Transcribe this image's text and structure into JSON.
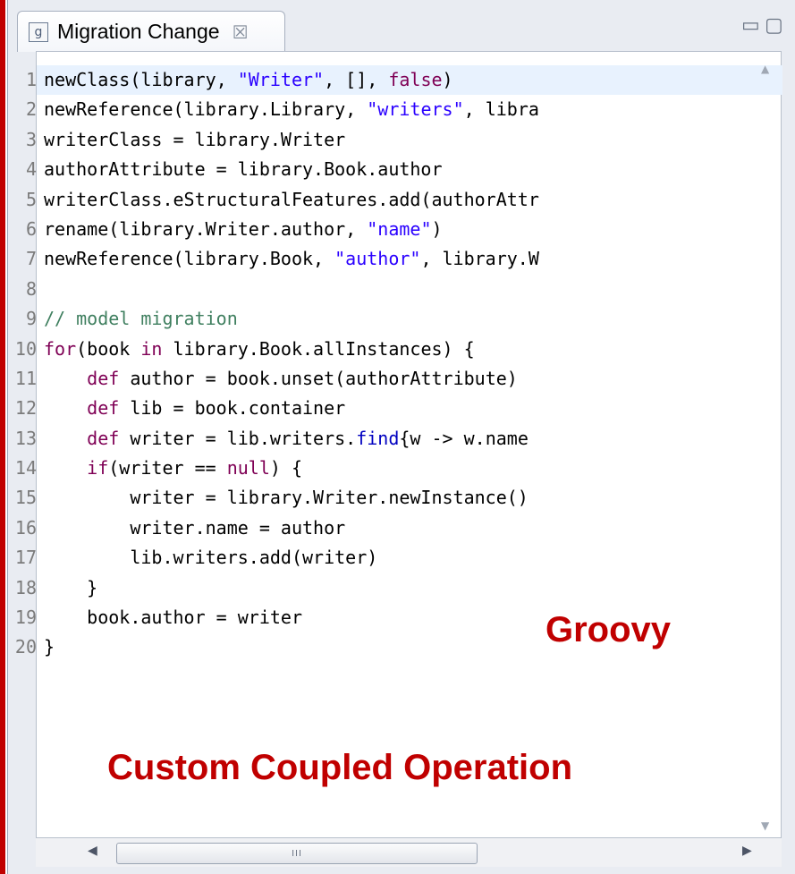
{
  "tab": {
    "icon_glyph": "g",
    "title": "Migration Change",
    "close_glyph": "☒"
  },
  "view_controls": {
    "minimize_glyph": "▭",
    "maximize_glyph": "▢"
  },
  "code_lines": [
    {
      "num": "1",
      "tokens": [
        {
          "t": "newClass(library, ",
          "c": "code"
        },
        {
          "t": "\"Writer\"",
          "c": "str"
        },
        {
          "t": ", [], ",
          "c": "code"
        },
        {
          "t": "false",
          "c": "kw"
        },
        {
          "t": ")",
          "c": "code"
        }
      ]
    },
    {
      "num": "2",
      "tokens": [
        {
          "t": "newReference(library.Library, ",
          "c": "code"
        },
        {
          "t": "\"writers\"",
          "c": "str"
        },
        {
          "t": ", libra",
          "c": "code"
        }
      ]
    },
    {
      "num": "3",
      "tokens": [
        {
          "t": "writerClass = library.Writer",
          "c": "code"
        }
      ]
    },
    {
      "num": "4",
      "tokens": [
        {
          "t": "authorAttribute = library.Book.author",
          "c": "code"
        }
      ]
    },
    {
      "num": "5",
      "tokens": [
        {
          "t": "writerClass.eStructuralFeatures.add(authorAttr",
          "c": "code"
        }
      ]
    },
    {
      "num": "6",
      "tokens": [
        {
          "t": "rename(library.Writer.author, ",
          "c": "code"
        },
        {
          "t": "\"name\"",
          "c": "str"
        },
        {
          "t": ")",
          "c": "code"
        }
      ]
    },
    {
      "num": "7",
      "tokens": [
        {
          "t": "newReference(library.Book, ",
          "c": "code"
        },
        {
          "t": "\"author\"",
          "c": "str"
        },
        {
          "t": ", library.W",
          "c": "code"
        }
      ]
    },
    {
      "num": "8",
      "tokens": []
    },
    {
      "num": "9",
      "tokens": [
        {
          "t": "// model migration",
          "c": "cm"
        }
      ]
    },
    {
      "num": "10",
      "tokens": [
        {
          "t": "for",
          "c": "kw"
        },
        {
          "t": "(book ",
          "c": "code"
        },
        {
          "t": "in",
          "c": "kw"
        },
        {
          "t": " library.Book.allInstances) {",
          "c": "code"
        }
      ]
    },
    {
      "num": "11",
      "tokens": [
        {
          "t": "    ",
          "c": "code"
        },
        {
          "t": "def",
          "c": "kw"
        },
        {
          "t": " author = book.unset(authorAttribute)",
          "c": "code"
        }
      ]
    },
    {
      "num": "12",
      "tokens": [
        {
          "t": "    ",
          "c": "code"
        },
        {
          "t": "def",
          "c": "kw"
        },
        {
          "t": " lib = book.container",
          "c": "code"
        }
      ]
    },
    {
      "num": "13",
      "tokens": [
        {
          "t": "    ",
          "c": "code"
        },
        {
          "t": "def",
          "c": "kw"
        },
        {
          "t": " writer = lib.writers.",
          "c": "code"
        },
        {
          "t": "find",
          "c": "mt"
        },
        {
          "t": "{w -> w.name ",
          "c": "code"
        }
      ]
    },
    {
      "num": "14",
      "tokens": [
        {
          "t": "    ",
          "c": "code"
        },
        {
          "t": "if",
          "c": "kw"
        },
        {
          "t": "(writer == ",
          "c": "code"
        },
        {
          "t": "null",
          "c": "kw"
        },
        {
          "t": ") {",
          "c": "code"
        }
      ]
    },
    {
      "num": "15",
      "tokens": [
        {
          "t": "        writer = library.Writer.newInstance()",
          "c": "code"
        }
      ]
    },
    {
      "num": "16",
      "tokens": [
        {
          "t": "        writer.name = author",
          "c": "code"
        }
      ]
    },
    {
      "num": "17",
      "tokens": [
        {
          "t": "        lib.writers.add(writer)",
          "c": "code"
        }
      ]
    },
    {
      "num": "18",
      "tokens": [
        {
          "t": "    }",
          "c": "code"
        }
      ]
    },
    {
      "num": "19",
      "tokens": [
        {
          "t": "    book.author = writer",
          "c": "code"
        }
      ]
    },
    {
      "num": "20",
      "tokens": [
        {
          "t": "}",
          "c": "code"
        }
      ]
    }
  ],
  "scrollbar": {
    "up_glyph": "▲",
    "down_glyph": "▼",
    "left_glyph": "◀",
    "right_glyph": "▶",
    "thumb_grip": "III"
  },
  "overlay": {
    "language_label": "Groovy",
    "caption": "Custom Coupled Operation"
  },
  "colors": {
    "accent_red": "#c00000",
    "keyword": "#7f0055",
    "string": "#2a00ff",
    "comment": "#3f7f5f",
    "current_line": "#e8f2fe"
  }
}
